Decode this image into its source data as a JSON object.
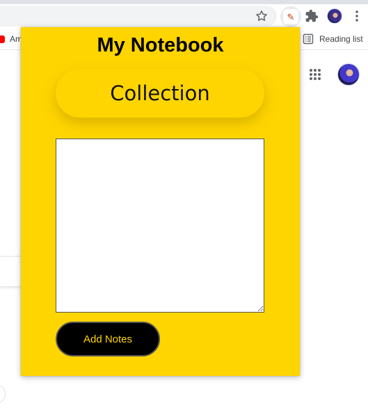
{
  "browser": {
    "bookmarks": {
      "amazon_label": "Am",
      "reading_list_label": "Reading list"
    }
  },
  "popup": {
    "title": "My Notebook",
    "collection_label": "Collection",
    "notes_value": "",
    "add_button_label": "Add Notes"
  },
  "colors": {
    "popup_background": "#ffd500",
    "button_background": "#000000",
    "button_text": "#ffd500"
  }
}
